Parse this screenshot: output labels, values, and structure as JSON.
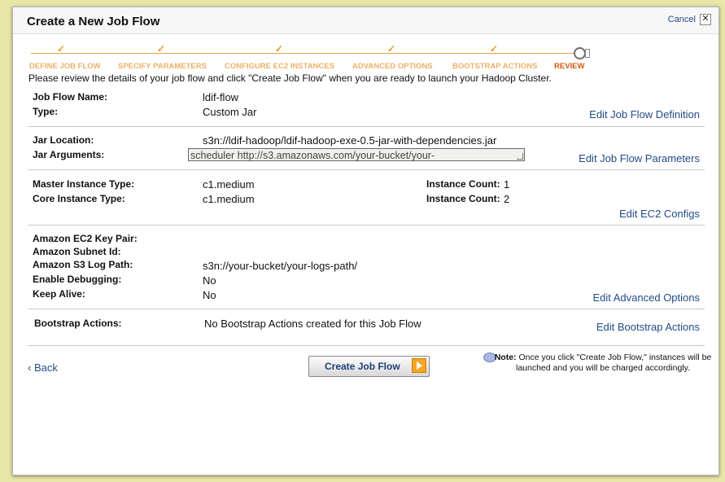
{
  "dialog": {
    "title": "Create a New Job Flow",
    "cancel_label": "Cancel",
    "close_glyph": "✕"
  },
  "steps": [
    {
      "label": "DEFINE JOB FLOW",
      "state": "done"
    },
    {
      "label": "SPECIFY PARAMETERS",
      "state": "done"
    },
    {
      "label": "CONFIGURE EC2 INSTANCES",
      "state": "done"
    },
    {
      "label": "ADVANCED OPTIONS",
      "state": "done"
    },
    {
      "label": "BOOTSTRAP ACTIONS",
      "state": "done"
    },
    {
      "label": "REVIEW",
      "state": "current"
    }
  ],
  "intro": "Please review the details of your job flow and click \"Create Job Flow\" when you are ready to launch your Hadoop Cluster.",
  "job_flow": {
    "name_label": "Job Flow Name:",
    "name": "ldif-flow",
    "type_label": "Type:",
    "type": "Custom Jar",
    "edit": "Edit Job Flow Definition"
  },
  "jar": {
    "location_label": "Jar Location:",
    "location": "s3n://ldif-hadoop/ldif-hadoop-exe-0.5-jar-with-dependencies.jar",
    "args_label": "Jar Arguments:",
    "args": "scheduler http://s3.amazonaws.com/your-bucket/your-",
    "edit": "Edit Job Flow Parameters"
  },
  "ec2": {
    "master_label": "Master Instance Type:",
    "master": "c1.medium",
    "core_label": "Core Instance Type:",
    "core": "c1.medium",
    "count_label": "Instance Count:",
    "master_count": "1",
    "core_count": "2",
    "edit": "Edit EC2 Configs"
  },
  "advanced": {
    "key_pair_label": "Amazon EC2 Key Pair:",
    "key_pair": "",
    "subnet_label": "Amazon Subnet Id:",
    "subnet": "",
    "log_path_label": "Amazon S3 Log Path:",
    "log_path": "s3n://your-bucket/your-logs-path/",
    "debug_label": "Enable Debugging:",
    "debug": "No",
    "keep_alive_label": "Keep Alive:",
    "keep_alive": "No",
    "edit": "Edit Advanced Options"
  },
  "bootstrap": {
    "label": "Bootstrap Actions:",
    "value": "No Bootstrap Actions created for this Job Flow",
    "edit": "Edit Bootstrap Actions"
  },
  "footer": {
    "back": "‹ Back",
    "create": "Create Job Flow",
    "note_label": "Note:",
    "note": "Once you click \"Create Job Flow,\" instances will be launched and you will be charged accordingly."
  },
  "colors": {
    "link": "#224b88",
    "step_done": "#edb066",
    "step_current": "#d45a11",
    "accent": "#f5a623"
  }
}
